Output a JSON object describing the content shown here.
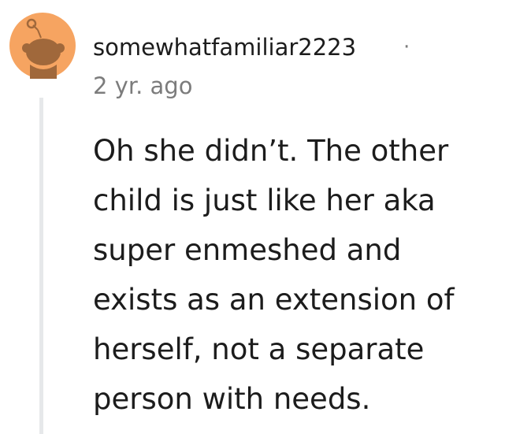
{
  "comment": {
    "author": "somewhatfamiliar2223",
    "separator": "·",
    "timestamp": "2 yr. ago",
    "body_lines": [
      "Oh she didn’t. The other",
      "child is just like her aka",
      "super enmeshed and",
      "exists as an extension of",
      "herself, not a separate",
      "person with needs."
    ]
  },
  "avatar": {
    "icon": "snoo-avatar-icon",
    "background_color": "#f6a461",
    "figure_color": "#a0683b"
  },
  "colors": {
    "text_primary": "#1c1c1c",
    "text_secondary": "#7c7c7c",
    "thread_line": "#e6e8ea"
  }
}
